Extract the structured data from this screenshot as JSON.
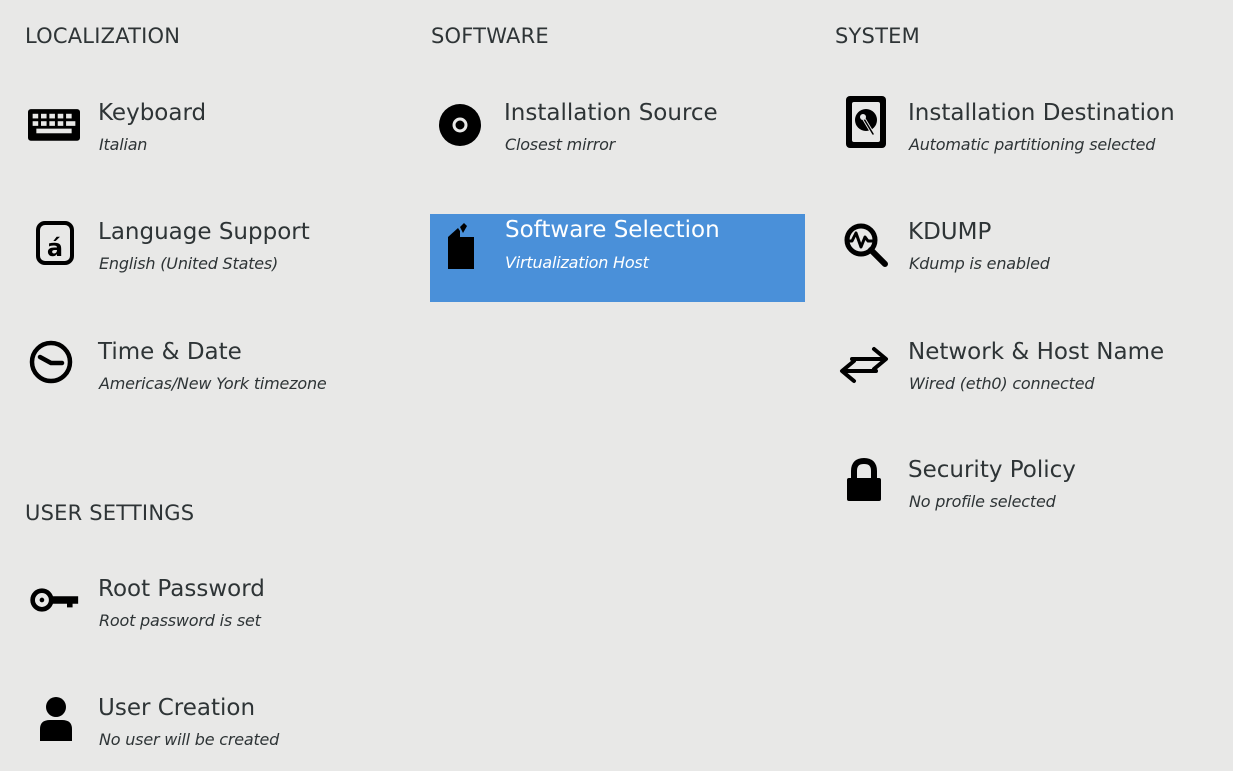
{
  "sections": {
    "localization": "LOCALIZATION",
    "software": "SOFTWARE",
    "system": "SYSTEM",
    "user_settings": "USER SETTINGS"
  },
  "colors": {
    "background": "#e8e8e7",
    "selected": "#4a90d9",
    "text": "#2e3436"
  },
  "spokes": {
    "keyboard": {
      "label": "Keyboard",
      "status": "Italian",
      "icon": "keyboard-icon"
    },
    "language": {
      "label": "Language Support",
      "status": "English (United States)",
      "icon": "language-icon"
    },
    "time": {
      "label": "Time & Date",
      "status": "Americas/New York timezone",
      "icon": "clock-icon"
    },
    "install_source": {
      "label": "Installation Source",
      "status": "Closest mirror",
      "icon": "disc-icon"
    },
    "software_selection": {
      "label": "Software Selection",
      "status": "Virtualization Host",
      "icon": "package-icon"
    },
    "install_dest": {
      "label": "Installation Destination",
      "status": "Automatic partitioning selected",
      "icon": "harddisk-icon"
    },
    "kdump": {
      "label": "KDUMP",
      "status": "Kdump is enabled",
      "icon": "magnifier-icon"
    },
    "network": {
      "label": "Network & Host Name",
      "status": "Wired (eth0) connected",
      "icon": "network-arrows-icon"
    },
    "security": {
      "label": "Security Policy",
      "status": "No profile selected",
      "icon": "lock-icon"
    },
    "root_password": {
      "label": "Root Password",
      "status": "Root password is set",
      "icon": "key-icon"
    },
    "user_creation": {
      "label": "User Creation",
      "status": "No user will be created",
      "icon": "user-icon"
    }
  }
}
